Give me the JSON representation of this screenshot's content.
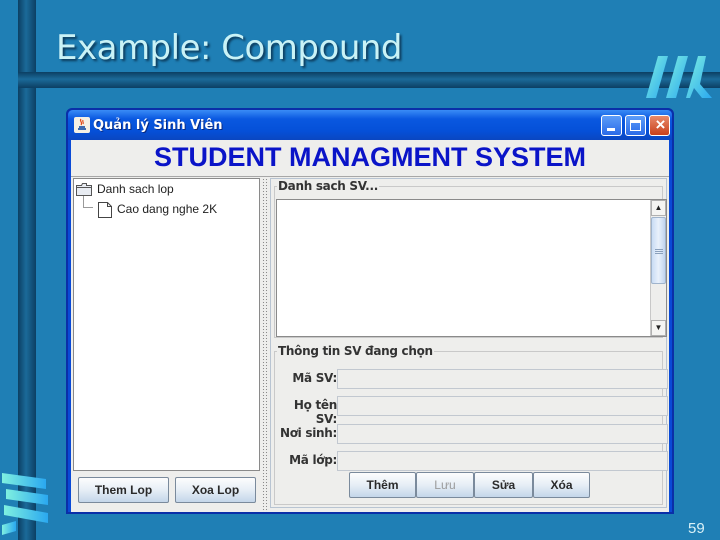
{
  "slide": {
    "title": "Example: Compound",
    "page_number": "59",
    "logo_icon": "slanted-stripes-logo-icon"
  },
  "window": {
    "title": "Quản lý Sinh Viên",
    "app_icon": "java-cup-icon",
    "controls": {
      "minimize": "minimize-icon",
      "maximize": "maximize-icon",
      "close": "×"
    }
  },
  "app": {
    "heading": "STUDENT MANAGMENT SYSTEM",
    "tree": {
      "root": {
        "label": "Danh sach lop",
        "icon": "folder-icon"
      },
      "children": [
        {
          "label": "Cao dang nghe 2K",
          "icon": "file-icon"
        }
      ]
    },
    "left_buttons": {
      "add_class": "Them Lop",
      "delete_class": "Xoa Lop"
    },
    "student_list": {
      "title": "Danh sach SV...",
      "items": []
    },
    "student_info": {
      "title": "Thông tin SV đang chọn",
      "fields": [
        {
          "label": "Mã SV:",
          "value": ""
        },
        {
          "label": "Họ tên SV:",
          "value": ""
        },
        {
          "label": "Nơi sinh:",
          "value": ""
        },
        {
          "label": "Mã lớp:",
          "value": ""
        }
      ]
    },
    "action_buttons": {
      "add": "Thêm",
      "save": "Lưu",
      "edit": "Sửa",
      "delete": "Xóa"
    }
  }
}
